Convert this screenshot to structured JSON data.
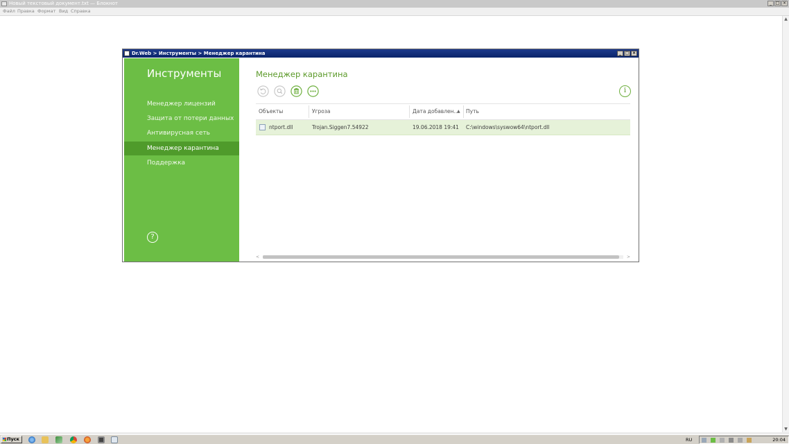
{
  "notepad": {
    "title": "Новый текстовый документ.txt — Блокнот",
    "menu": [
      "Файл",
      "Правка",
      "Формат",
      "Вид",
      "Справка"
    ],
    "controls": [
      "_",
      "□",
      "×"
    ]
  },
  "drweb": {
    "title": "Dr.Web > Инструменты > Менеджер карантина",
    "controls": [
      "_",
      "□",
      "×"
    ],
    "sidebar": {
      "heading": "Инструменты",
      "items": [
        {
          "label": "Менеджер лицензий",
          "active": false
        },
        {
          "label": "Защита от потери данных",
          "active": false
        },
        {
          "label": "Антивирусная сеть",
          "active": false
        },
        {
          "label": "Менеджер карантина",
          "active": true
        },
        {
          "label": "Поддержка",
          "active": false
        }
      ],
      "help_glyph": "?"
    },
    "main": {
      "heading": "Менеджер карантина",
      "toolbar": [
        {
          "name": "restore-icon",
          "enabled": false
        },
        {
          "name": "rescan-icon",
          "enabled": false
        },
        {
          "name": "delete-icon",
          "enabled": true
        },
        {
          "name": "more-icon",
          "enabled": true
        }
      ],
      "info_glyph": "i",
      "columns": [
        "Объекты",
        "Угроза",
        "Дата добавлен...",
        "Путь"
      ],
      "sort_indicator": "▲",
      "rows": [
        {
          "object": "ntport.dll",
          "threat": "Trojan.Siggen7.54922",
          "date": "19.06.2018 19:41",
          "path": "C:\\windows\\syswow64\\ntport.dll"
        }
      ],
      "scroll_left": "<",
      "scroll_right": ">"
    }
  },
  "taskbar": {
    "start_label": "Пуск",
    "language": "RU",
    "time": "20:04"
  },
  "colors": {
    "sidebar_green": "#6cbe45",
    "sidebar_active": "#4f9b2b",
    "heading_green": "#5c9a2a",
    "row_selected": "#e6f2d9",
    "titlebar_blue": "#0a246a"
  }
}
